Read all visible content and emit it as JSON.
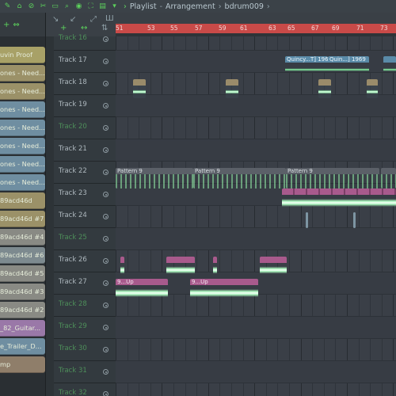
{
  "window": {
    "breadcrumb": [
      "Playlist",
      "Arrangement",
      "bdrum009"
    ],
    "colors": {
      "accent": "#62d662",
      "ruler": "#c94a48"
    }
  },
  "toolbar_icons": [
    "arrow-icon",
    "snap-icon",
    "mute-icon",
    "slice-icon",
    "zoom-icon",
    "select-icon",
    "draw-icon",
    "play-icon",
    "scroll-icon",
    "pattern-icon",
    "down-arrow-icon"
  ],
  "ruler": {
    "marks": [
      "51",
      "53",
      "55",
      "57",
      "59",
      "61",
      "63",
      "65",
      "67",
      "69",
      "71",
      "73"
    ]
  },
  "channels": [
    "uvin Proof",
    "ones - Need...",
    "ones - Need...",
    "ones - Need...",
    "ones - Need...",
    "ones - Need...",
    "ones - Need...",
    "ones - Need...",
    "89acd46d",
    "89acd46d #7",
    "89acd46d #4",
    "89acd46d #6",
    "89acd46d #5",
    "89acd46d #3",
    "89acd46d #2",
    "_82_Guitar...",
    "e_Trailer_D...",
    "mp"
  ],
  "tracks": [
    {
      "name": "Track 16",
      "dim": true
    },
    {
      "name": "Track 17",
      "dim": false
    },
    {
      "name": "Track 18",
      "dim": false
    },
    {
      "name": "Track 19",
      "dim": false
    },
    {
      "name": "Track 20",
      "dim": true
    },
    {
      "name": "Track 21",
      "dim": false
    },
    {
      "name": "Track 22",
      "dim": false
    },
    {
      "name": "Track 23",
      "dim": false
    },
    {
      "name": "Track 24",
      "dim": false
    },
    {
      "name": "Track 25",
      "dim": true
    },
    {
      "name": "Track 26",
      "dim": false
    },
    {
      "name": "Track 27",
      "dim": false
    },
    {
      "name": "Track 28",
      "dim": true
    },
    {
      "name": "Track 29",
      "dim": true
    },
    {
      "name": "Track 30",
      "dim": true
    },
    {
      "name": "Track 31",
      "dim": true
    },
    {
      "name": "Track 32",
      "dim": true
    }
  ],
  "clips": {
    "quincy": "Quincy...T] 1969",
    "quin": "Quin...] 1969",
    "pattern9": "Pattern 9",
    "up": "9...Up",
    "up2": "9...Up"
  }
}
